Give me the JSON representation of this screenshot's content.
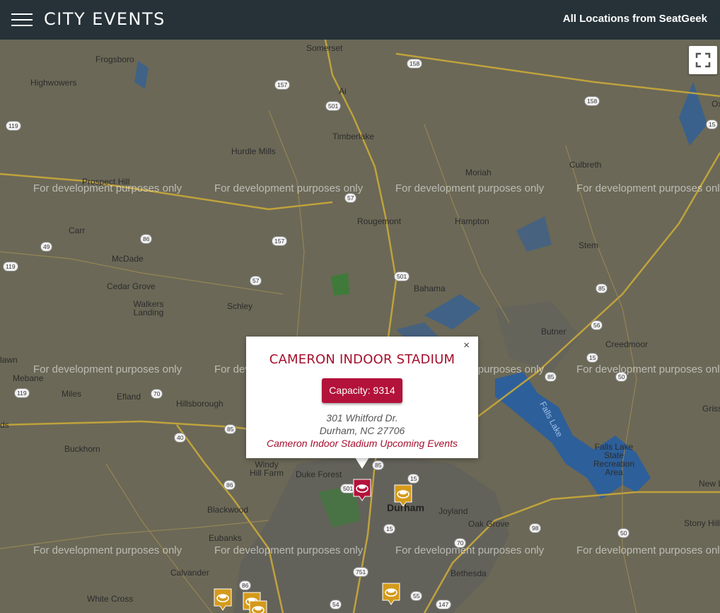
{
  "header": {
    "app_title": "CITY EVENTS",
    "source_link": "All Locations from SeatGeek"
  },
  "map": {
    "watermark": "For development purposes only",
    "places": [
      "Somerset",
      "Frogsboro",
      "Highwowers",
      "Ai",
      "Timberlake",
      "Hurdle Mills",
      "Moriah",
      "Culbreth",
      "Prospect Hill",
      "Rougemont",
      "Hampton",
      "Carr",
      "McDade",
      "Stem",
      "Bahama",
      "Cedar Grove",
      "Walkers Landing",
      "Schley",
      "Butner",
      "Creedmoor",
      "Mebane",
      "Miles",
      "Efland",
      "Hillsborough",
      "Buckhorn",
      "Windy Hill Farm",
      "Duke Forest",
      "Durham",
      "Joyland",
      "Falls Lake State Recreation Area",
      "Oak Grove",
      "Blackwood",
      "Eubanks",
      "Calvander",
      "Bethesda",
      "White Cross",
      "Stony Hill",
      "New L",
      "Griss",
      "Ox",
      "Falls Lake",
      "lawn",
      "ds"
    ],
    "road_shields": [
      "158",
      "157",
      "501",
      "119",
      "15",
      "158",
      "57",
      "86",
      "49",
      "157",
      "119",
      "501",
      "57",
      "85",
      "56",
      "15",
      "50",
      "119",
      "70",
      "85",
      "40",
      "85",
      "85",
      "15",
      "86",
      "501",
      "15",
      "98",
      "50",
      "70",
      "751",
      "86",
      "55",
      "54",
      "147"
    ]
  },
  "popup": {
    "venue_name": "CAMERON INDOOR STADIUM",
    "capacity_label": "Capacity: 9314",
    "address_line1": "301 Whitford Dr.",
    "address_line2": "Durham, NC 27706",
    "events_link": "Cameron Indoor Stadium Upcoming Events",
    "close_symbol": "×"
  },
  "colors": {
    "header_bg": "#263238",
    "map_land": "#6b6857",
    "water": "#2d5f9a",
    "road_major": "#c9a93a",
    "accent_red": "#b3123a",
    "marker_gold": "#d49a1a"
  },
  "markers": [
    {
      "kind": "selected-venue",
      "icon": "stadium-icon"
    },
    {
      "kind": "venue",
      "icon": "stadium-icon"
    },
    {
      "kind": "venue",
      "icon": "stadium-icon"
    },
    {
      "kind": "venue",
      "icon": "stadium-icon"
    },
    {
      "kind": "venue",
      "icon": "stadium-icon"
    },
    {
      "kind": "venue",
      "icon": "stadium-icon"
    }
  ]
}
